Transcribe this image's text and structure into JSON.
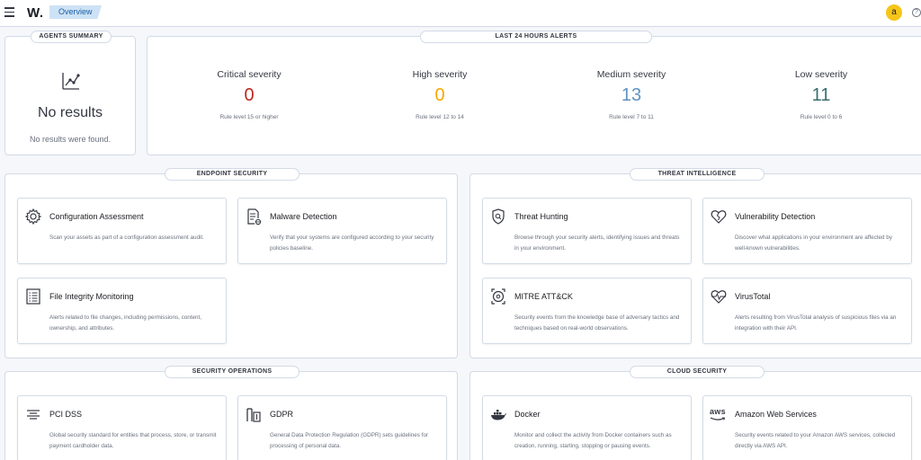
{
  "header": {
    "logo": "W.",
    "breadcrumb": "Overview",
    "avatar": "a",
    "help_glyph": "?"
  },
  "agents_summary": {
    "title": "AGENTS SUMMARY",
    "no_results_title": "No results",
    "no_results_sub": "No results were found."
  },
  "alerts": {
    "title": "LAST 24 HOURS ALERTS",
    "items": [
      {
        "label": "Critical severity",
        "value": "0",
        "rule": "Rule level 15 or higher",
        "color": "#bd271e"
      },
      {
        "label": "High severity",
        "value": "0",
        "rule": "Rule level 12 to 14",
        "color": "#f5a700"
      },
      {
        "label": "Medium severity",
        "value": "13",
        "rule": "Rule level 7 to 11",
        "color": "#6092c0"
      },
      {
        "label": "Low severity",
        "value": "11",
        "rule": "Rule level 0 to 6",
        "color": "#3b6e6e"
      }
    ]
  },
  "sections": {
    "endpoint": {
      "title": "ENDPOINT SECURITY",
      "cards": [
        {
          "icon": "gear-icon",
          "title": "Configuration Assessment",
          "desc": "Scan your assets as part of a configuration assessment audit."
        },
        {
          "icon": "malware-icon",
          "title": "Malware Detection",
          "desc": "Verify that your systems are configured according to your security policies baseline."
        },
        {
          "icon": "file-list-icon",
          "title": "File Integrity Monitoring",
          "desc": "Alerts related to file changes, including permissions, content, ownership, and attributes."
        }
      ]
    },
    "threat": {
      "title": "THREAT INTELLIGENCE",
      "cards": [
        {
          "icon": "shield-search-icon",
          "title": "Threat Hunting",
          "desc": "Browse through your security alerts, identifying issues and threats in your environment."
        },
        {
          "icon": "heart-icon",
          "title": "Vulnerability Detection",
          "desc": "Discover what applications in your environment are affected by well-known vulnerabilities."
        },
        {
          "icon": "target-icon",
          "title": "MITRE ATT&CK",
          "desc": "Security events from the knowledge base of adversary tactics and techniques based on real-world observations."
        },
        {
          "icon": "pulse-heart-icon",
          "title": "VirusTotal",
          "desc": "Alerts resulting from VirusTotal analysis of suspicious files via an integration with their API."
        }
      ]
    },
    "secops": {
      "title": "SECURITY OPERATIONS",
      "cards": [
        {
          "icon": "layers-icon",
          "title": "PCI DSS",
          "desc": "Global security standard for entities that process, store, or transmit payment cardholder data."
        },
        {
          "icon": "building-icon",
          "title": "GDPR",
          "desc": "General Data Protection Regulation (GDPR) sets guidelines for processing of personal data."
        }
      ]
    },
    "cloud": {
      "title": "CLOUD SECURITY",
      "cards": [
        {
          "icon": "docker-icon",
          "title": "Docker",
          "desc": "Monitor and collect the activity from Docker containers such as creation, running, starting, stopping or pausing events."
        },
        {
          "icon": "aws-icon",
          "title": "Amazon Web Services",
          "desc": "Security events related to your Amazon AWS services, collected directly via AWS API.",
          "icon_text": "aws"
        }
      ]
    }
  }
}
